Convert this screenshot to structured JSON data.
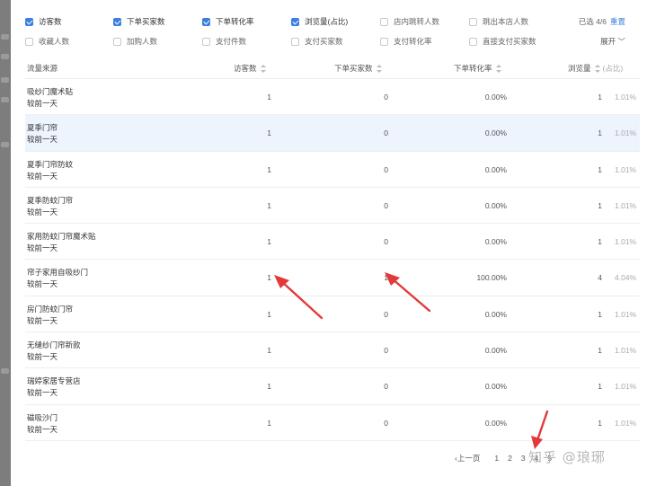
{
  "filters": {
    "row1": [
      {
        "label": "访客数",
        "checked": true
      },
      {
        "label": "下单买家数",
        "checked": true
      },
      {
        "label": "下单转化率",
        "checked": true
      },
      {
        "label": "浏览量(占比)",
        "checked": true
      },
      {
        "label": "店内跳转人数",
        "checked": false
      },
      {
        "label": "跳出本店人数",
        "checked": false
      }
    ],
    "row2": [
      {
        "label": "收藏人数",
        "checked": false
      },
      {
        "label": "加购人数",
        "checked": false
      },
      {
        "label": "支付件数",
        "checked": false
      },
      {
        "label": "支付买家数",
        "checked": false
      },
      {
        "label": "支付转化率",
        "checked": false
      },
      {
        "label": "直接支付买家数",
        "checked": false
      }
    ],
    "selected_text": "已选 4/6",
    "reset_label": "重置",
    "expand_label": "展开 ﹀"
  },
  "table": {
    "headers": {
      "source": "流量来源",
      "visitors": "访客数",
      "buyers": "下单买家数",
      "conversion": "下单转化率",
      "pageviews": "浏览量",
      "share": "(占比)"
    },
    "rows": [
      {
        "name": "吸纱门魔术贴",
        "sub": "较前一天",
        "visitors": "1",
        "buyers": "0",
        "conversion": "0.00%",
        "pageviews": "1",
        "share": "1.01%"
      },
      {
        "name": "夏季门帘",
        "sub": "较前一天",
        "visitors": "1",
        "buyers": "0",
        "conversion": "0.00%",
        "pageviews": "1",
        "share": "1.01%"
      },
      {
        "name": "夏季门帘防蚊",
        "sub": "较前一天",
        "visitors": "1",
        "buyers": "0",
        "conversion": "0.00%",
        "pageviews": "1",
        "share": "1.01%"
      },
      {
        "name": "夏季防蚊门帘",
        "sub": "较前一天",
        "visitors": "1",
        "buyers": "0",
        "conversion": "0.00%",
        "pageviews": "1",
        "share": "1.01%"
      },
      {
        "name": "家用防蚊门帘魔术贴",
        "sub": "较前一天",
        "visitors": "1",
        "buyers": "0",
        "conversion": "0.00%",
        "pageviews": "1",
        "share": "1.01%"
      },
      {
        "name": "帘子家用自吸纱门",
        "sub": "较前一天",
        "visitors": "1",
        "buyers": "1",
        "conversion": "100.00%",
        "pageviews": "4",
        "share": "4.04%"
      },
      {
        "name": "房门防蚊门帘",
        "sub": "较前一天",
        "visitors": "1",
        "buyers": "0",
        "conversion": "0.00%",
        "pageviews": "1",
        "share": "1.01%"
      },
      {
        "name": "无缝纱门帘新款",
        "sub": "较前一天",
        "visitors": "1",
        "buyers": "0",
        "conversion": "0.00%",
        "pageviews": "1",
        "share": "1.01%"
      },
      {
        "name": "瑞婷家居专营店",
        "sub": "较前一天",
        "visitors": "1",
        "buyers": "0",
        "conversion": "0.00%",
        "pageviews": "1",
        "share": "1.01%"
      },
      {
        "name": "磁吸沙门",
        "sub": "较前一天",
        "visitors": "1",
        "buyers": "0",
        "conversion": "0.00%",
        "pageviews": "1",
        "share": "1.01%"
      }
    ]
  },
  "pagination": {
    "prev_label": "‹上一页",
    "pages": [
      "1",
      "2",
      "3",
      "4",
      "5"
    ]
  },
  "watermark": "知乎 @琅琊",
  "colors": {
    "accent": "#3d7fe0",
    "annotation_arrow": "#e23a3a",
    "row_highlight": "#edf4fd"
  }
}
